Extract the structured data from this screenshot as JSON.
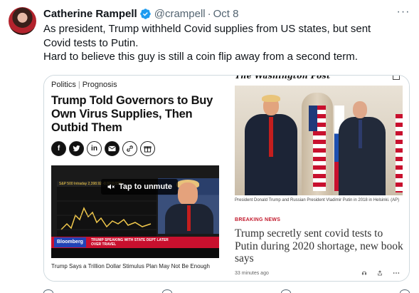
{
  "tweet": {
    "display_name": "Catherine Rampell",
    "handle": "@crampell",
    "separator": "·",
    "date": "Oct 8",
    "more_label": "···",
    "text_line1": "As president, Trump withheld Covid supplies from US states, but sent Covid tests to Putin.",
    "text_line2": "Hard to believe this guy is still a coin flip away from a second term.",
    "verified_color": "#1d9bf0",
    "icons": [
      "avatar",
      "verified-badge-icon",
      "more-icon"
    ]
  },
  "card_left": {
    "section": "Politics",
    "section_sep": "|",
    "subsection": "Prognosis",
    "headline": "Trump Told Governors to Buy Own Virus Supplies, Then Outbid Them",
    "share_icons": [
      "facebook-icon",
      "twitter-icon",
      "linkedin-icon",
      "email-icon",
      "link-icon",
      "gift-icon"
    ],
    "video": {
      "unmute_label": "Tap to unmute",
      "ticker": "S&P 500 Intraday 2,398.92 -0.92 0.03%",
      "source_label": "Bloomberg",
      "banner_text": "TRUMP SPEAKING WITH STATE DEPT LATER OVER TRAVEL"
    },
    "caption": "Trump Says a Trillion Dollar Stimulus Plan May Not Be Enough"
  },
  "card_right": {
    "logo": "The Washington Post",
    "photo_caption": "President Donald Trump and Russian President Vladimir Putin in 2018 in Helsinki. (AP)",
    "label": "BREAKING NEWS",
    "headline": "Trump secretly sent covid tests to Putin during 2020 shortage, new book says",
    "time": "33 minutes ago",
    "footer_icons": [
      "listen-icon",
      "share-icon",
      "more-icon"
    ]
  }
}
